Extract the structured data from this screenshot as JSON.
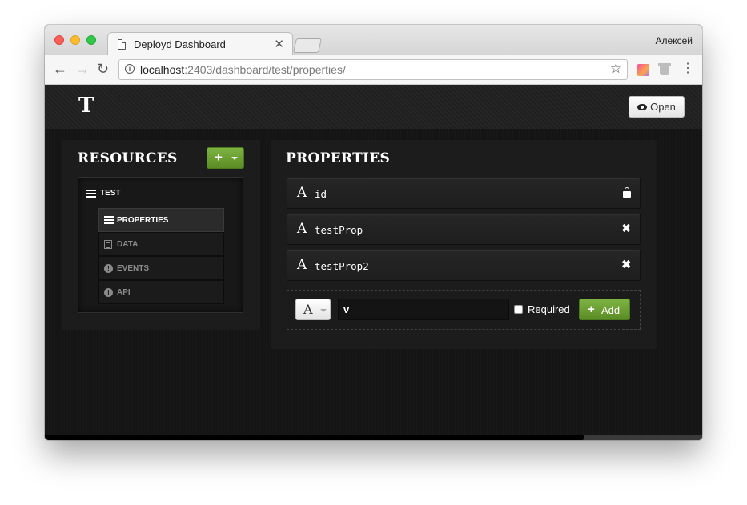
{
  "browser": {
    "tab_title": "Deployd Dashboard",
    "tab_close": "✕",
    "user_name": "Алексей",
    "url_host": "localhost",
    "url_rest": ":2403/dashboard/test/properties/",
    "back_glyph": "←",
    "forward_glyph": "→",
    "reload_glyph": "↻",
    "star_glyph": "☆",
    "menu_glyph": "⋮",
    "info_glyph": "i"
  },
  "app": {
    "logo": "T",
    "open_button": "Open"
  },
  "resources": {
    "heading": "RESOURCES",
    "add_button": "+",
    "root": "TEST",
    "items": [
      {
        "label": "PROPERTIES",
        "icon": "list-icon",
        "active": true
      },
      {
        "label": "DATA",
        "icon": "grid-icon",
        "active": false
      },
      {
        "label": "EVENTS",
        "icon": "exclamation-icon",
        "glyph": "!",
        "active": false
      },
      {
        "label": "API",
        "icon": "info-icon",
        "glyph": "i",
        "active": false
      }
    ]
  },
  "properties": {
    "heading": "PROPERTIES",
    "type_glyph": "A",
    "rows": [
      {
        "name": "id",
        "action_icon": "lock-icon"
      },
      {
        "name": "testProp",
        "action_icon": "remove-icon",
        "glyph": "✖"
      },
      {
        "name": "testProp2",
        "action_icon": "remove-icon",
        "glyph": "✖"
      }
    ],
    "new_property": {
      "type_value": "A",
      "name_value": "v",
      "required_label": "Required",
      "required_checked": false,
      "add_label": "Add",
      "add_glyph": "+"
    }
  },
  "colors": {
    "accent_green": "#6a9f2f",
    "page_bg": "#151515"
  }
}
